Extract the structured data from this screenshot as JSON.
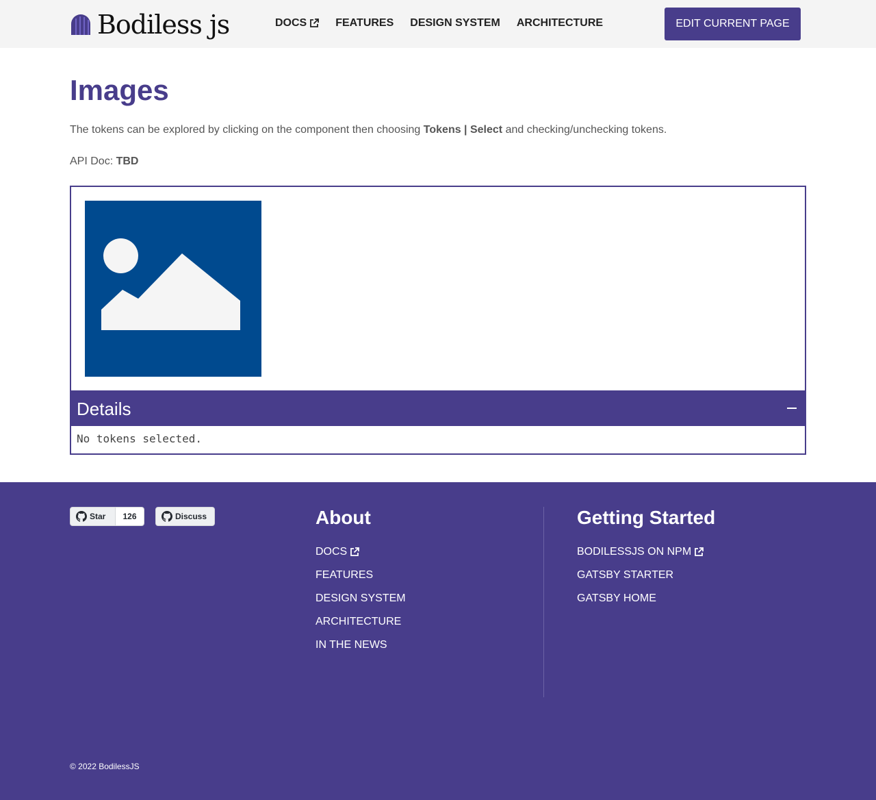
{
  "header": {
    "logo_text": "Bodiless js",
    "nav": [
      {
        "label": "DOCS",
        "external": true
      },
      {
        "label": "FEATURES"
      },
      {
        "label": "DESIGN SYSTEM"
      },
      {
        "label": "ARCHITECTURE"
      }
    ],
    "edit_button": "EDIT CURRENT PAGE"
  },
  "main": {
    "title": "Images",
    "intro_prefix": "The tokens can be explored by clicking on  the component then choosing ",
    "intro_bold": "Tokens | Select",
    "intro_suffix": " and checking/unchecking tokens.",
    "api_doc_label": "API Doc: ",
    "api_doc_value": "TBD",
    "details_title": "Details",
    "no_tokens": "No tokens selected."
  },
  "footer": {
    "star_label": "Star",
    "star_count": "126",
    "discuss_label": "Discuss",
    "about": {
      "heading": "About",
      "links": [
        "DOCS",
        "FEATURES",
        "DESIGN SYSTEM",
        "ARCHITECTURE",
        "IN THE NEWS"
      ]
    },
    "getting_started": {
      "heading": "Getting Started",
      "links": [
        "BODILESSJS ON NPM",
        "GATSBY STARTER",
        "GATSBY HOME"
      ]
    },
    "copyright": "©  2022 BodilessJS"
  },
  "colors": {
    "brand": "#483d8b",
    "image_placeholder_bg": "#004a8f",
    "header_bg": "#f4f4f4"
  }
}
